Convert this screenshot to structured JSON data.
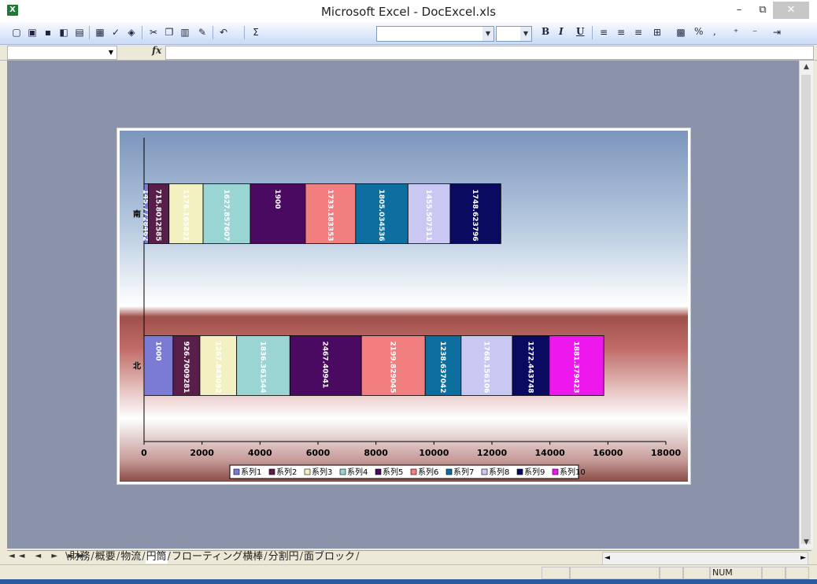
{
  "app": {
    "title": "Microsoft Excel - DocExcel.xls",
    "icon": "excel-icon"
  },
  "window_controls": {
    "minimize": "–",
    "restore": "⧉",
    "close": "✕"
  },
  "toolbar": {
    "icons": [
      "new-icon",
      "open-icon",
      "save-icon",
      "permission-icon",
      "print-icon",
      "print-preview-icon",
      "spelling-icon",
      "research-icon",
      "cut-icon",
      "copy-icon",
      "paste-icon",
      "format-painter-icon",
      "undo-icon",
      "autosum-icon",
      "bold-icon",
      "italic-icon",
      "underline-icon",
      "align-left-icon",
      "center-icon",
      "align-right-icon",
      "merge-center-icon",
      "currency-icon",
      "percent-icon",
      "comma-icon",
      "increase-decimal-icon",
      "decrease-decimal-icon",
      "indent-icon"
    ],
    "sigma": "Σ",
    "bold": "B",
    "italic": "I",
    "underline": "U",
    "percent": "%",
    "comma": ","
  },
  "formula_bar": {
    "fx": "fx",
    "name_box": "",
    "formula": ""
  },
  "sheet_tabs": {
    "nav": "◄◄ ◄ ► ►►",
    "tabs": [
      "財務",
      "概要",
      "物流",
      "円筒",
      "フローティング横棒",
      "分割円",
      "面ブロック"
    ],
    "active_index": 3
  },
  "status_bar": {
    "num": "NUM"
  },
  "chart_data": {
    "type": "bar",
    "orientation": "horizontal",
    "stacked": true,
    "categories": [
      "北",
      "南"
    ],
    "xlim": [
      0,
      18000
    ],
    "xticks": [
      "0",
      "2000",
      "4000",
      "6000",
      "8000",
      "10000",
      "12000",
      "14000",
      "16000",
      "18000"
    ],
    "legend_position": "bottom",
    "grid": false,
    "series": [
      {
        "name": "系列1",
        "color": "#7b7bd6",
        "values": [
          1000,
          145.7728462
        ],
        "labels": [
          "1000",
          "145.7728462"
        ]
      },
      {
        "name": "系列2",
        "color": "#5a1e4a",
        "values": [
          926.7009281,
          715.8012585
        ],
        "labels": [
          "926.7009281",
          "715.8012585"
        ]
      },
      {
        "name": "系列3",
        "color": "#f3f0c2",
        "values": [
          1267.843092,
          1176.165821
        ],
        "labels": [
          "1267.843092",
          "1176.165821"
        ]
      },
      {
        "name": "系列4",
        "color": "#9ad5d3",
        "values": [
          1836.361544,
          1627.857607
        ],
        "labels": [
          "1836.361544",
          "1627.857607"
        ]
      },
      {
        "name": "系列5",
        "color": "#4b0a62",
        "values": [
          2467.40941,
          1900
        ],
        "labels": [
          "2467.40941",
          "1900"
        ]
      },
      {
        "name": "系列6",
        "color": "#f27f7f",
        "values": [
          2199.829045,
          1733.183353
        ],
        "labels": [
          "2199.829045",
          "1733.183353"
        ]
      },
      {
        "name": "系列7",
        "color": "#0c6fa0",
        "values": [
          1238.637042,
          1805.034536
        ],
        "labels": [
          "1238.637042",
          "1805.034536"
        ]
      },
      {
        "name": "系列8",
        "color": "#c8c8f2",
        "values": [
          1768.156106,
          1455.507311
        ],
        "labels": [
          "1768.156106",
          "1455.507311"
        ]
      },
      {
        "name": "系列9",
        "color": "#0a0a60",
        "values": [
          1272.443748,
          1748.623796
        ],
        "labels": [
          "1272.443748",
          "1748.623796"
        ]
      },
      {
        "name": "系列10",
        "color": "#ee18ee",
        "values": [
          1881.379423,
          0
        ],
        "labels": [
          "1881.379423",
          ""
        ]
      }
    ],
    "label_color": "#ffffff"
  }
}
